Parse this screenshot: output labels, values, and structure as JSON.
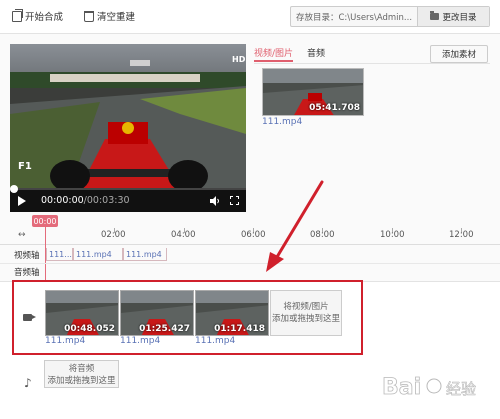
{
  "toolbar": {
    "start_label": "开始合成",
    "clear_label": "清空重建",
    "output_dir_label": "存放目录：C:\\Users\\Admin...",
    "change_dir_label": "更改目录"
  },
  "player": {
    "current_time": "00:00:00",
    "total_time": "/00:03:30",
    "progress": 0
  },
  "media_panel": {
    "tabs": [
      {
        "label": "视频/图片",
        "active": true
      },
      {
        "label": "音频",
        "active": false
      }
    ],
    "add_material_label": "添加素材",
    "items": [
      {
        "name": "111.mp4",
        "duration": "05:41.708"
      }
    ]
  },
  "timeline": {
    "playhead_label": "00:00",
    "ruler_labels": [
      "02:00",
      "04:00",
      "06:00",
      "08:00",
      "10:00",
      "12:00"
    ],
    "video_track_label": "视频轴",
    "audio_track_label": "音频轴",
    "video_segments": [
      "111...",
      "111.mp4",
      "111.mp4"
    ]
  },
  "clips": [
    {
      "name": "111.mp4",
      "duration": "00:48.052"
    },
    {
      "name": "111.mp4",
      "duration": "01:25.427"
    },
    {
      "name": "111.mp4",
      "duration": "01:17.418"
    }
  ],
  "drop_video": {
    "line1": "将视频/图片",
    "line2": "添加或拖拽到这里"
  },
  "drop_audio": {
    "line1": "将音频",
    "line2": "添加或拖拽到这里"
  },
  "icons": {
    "start": "copy-icon",
    "clear": "trash-icon",
    "folder": "folder-icon",
    "play": "play-icon",
    "volume": "volume-icon",
    "fullscreen": "fullscreen-icon",
    "camera": "camera-icon",
    "music": "music-icon"
  },
  "colors": {
    "accent": "#e05f6e",
    "highlight_box": "#d0202c",
    "link": "#5a72b5"
  },
  "watermark": {
    "brand": "Bai",
    "sub": "经验"
  }
}
